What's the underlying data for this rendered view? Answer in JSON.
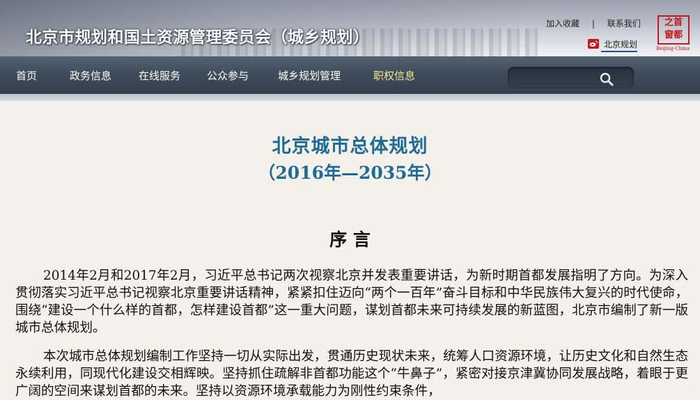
{
  "header": {
    "site_title": "北京市规划和国土资源管理委员会（城乡规划）",
    "links": {
      "bookmark": "加入收藏",
      "separator": "|",
      "contact": "联系我们"
    },
    "weibo": {
      "label": "北京规划",
      "icon": "weibo-icon"
    },
    "logo": {
      "chars": [
        "首",
        "都",
        "之",
        "窗"
      ],
      "caption": "Beijing-China"
    }
  },
  "nav": {
    "items": [
      {
        "label": "首页"
      },
      {
        "label": "政务信息"
      },
      {
        "label": "在线服务"
      },
      {
        "label": "公众参与"
      },
      {
        "label": "城乡规划管理"
      },
      {
        "label": "职权信息",
        "active": true
      }
    ],
    "search": {
      "placeholder": "",
      "icon": "search-icon"
    },
    "active_color": "#f6e98f"
  },
  "document": {
    "title": "北京城市总体规划",
    "period": "（2016年—2035年）",
    "section_title": "序  言",
    "paragraphs": [
      "2014年2月和2017年2月，习近平总书记两次视察北京并发表重要讲话，为新时期首都发展指明了方向。为深入贯彻落实习近平总书记视察北京重要讲话精神，紧紧扣住迈向“两个一百年”奋斗目标和中华民族伟大复兴的时代使命，围绕“建设一个什么样的首都，怎样建设首都”这一重大问题，谋划首都未来可持续发展的新蓝图，北京市编制了新一版城市总体规划。",
      "本次城市总体规划编制工作坚持一切从实际出发，贯通历史现状未来，统筹人口资源环境，让历史文化和自然生态永续利用，同现代化建设交相辉映。坚持抓住疏解非首都功能这个“牛鼻子”，紧密对接京津冀协同发展战略，着眼于更广阔的空间来谋划首都的未来。坚持以资源环境承载能力为刚性约束条件，"
    ],
    "title_color": "#1e6b97"
  }
}
